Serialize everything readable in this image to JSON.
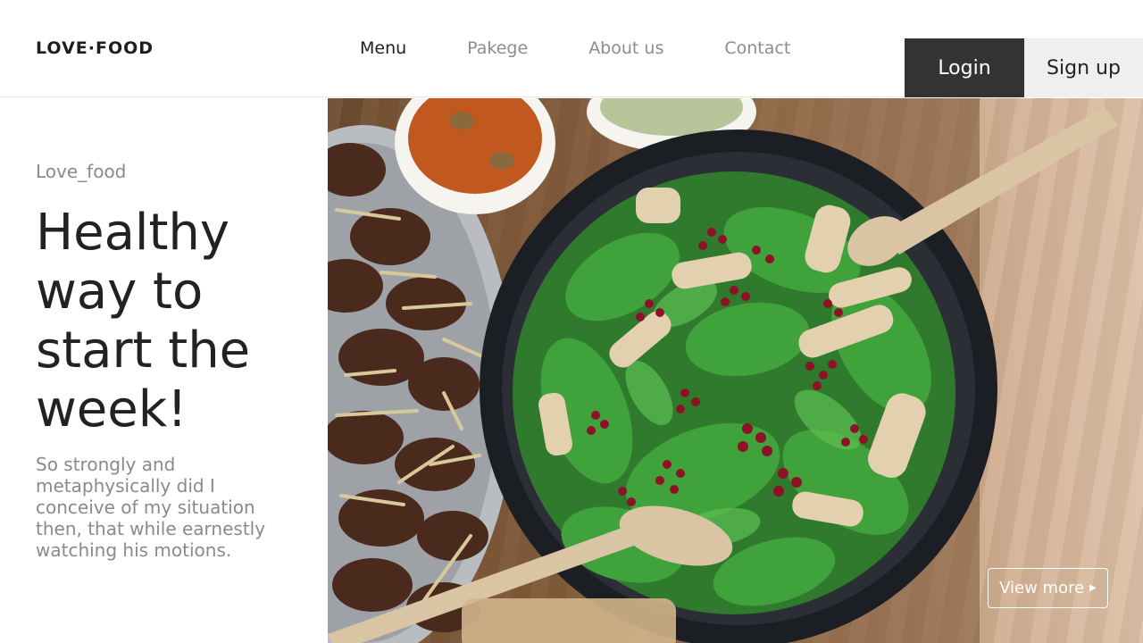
{
  "brand": {
    "logo": "LOVE·FOOD"
  },
  "nav": {
    "items": [
      {
        "label": "Menu",
        "active": true
      },
      {
        "label": "Pakege",
        "active": false
      },
      {
        "label": "About us",
        "active": false
      },
      {
        "label": "Contact",
        "active": false
      }
    ]
  },
  "auth": {
    "login_label": "Login",
    "signup_label": "Sign up"
  },
  "hero": {
    "eyebrow": "Love_food",
    "headline": "Healthy way to start the week!",
    "blurb": "So strongly and metaphysically did I conceive of my situation then, that while earnestly watching his motions.",
    "cta_label": "View more",
    "cta_icon": "caret-right-icon"
  },
  "colors": {
    "login_bg": "#333333",
    "signup_bg": "#efefef",
    "nav_active": "#1e1e1e",
    "nav_inactive": "#8c8c8c",
    "body_gray": "#8a8a8a"
  }
}
